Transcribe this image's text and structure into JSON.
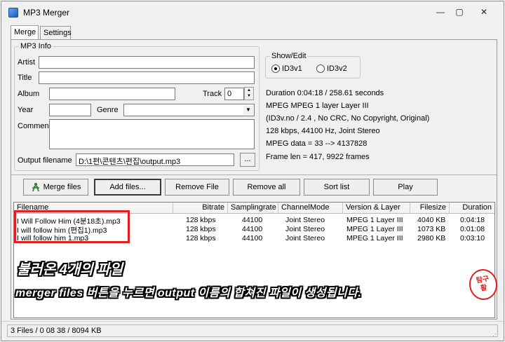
{
  "window": {
    "title": "MP3 Merger",
    "controls": {
      "minimize": "—",
      "maximize": "▢",
      "close": "✕"
    }
  },
  "tabs": [
    {
      "label": "Merge",
      "active": true
    },
    {
      "label": "Settings",
      "active": false
    }
  ],
  "mp3_info": {
    "legend": "MP3 Info",
    "artist_label": "Artist",
    "artist_value": "",
    "title_label": "Title",
    "title_value": "",
    "album_label": "Album",
    "album_value": "",
    "track_label": "Track",
    "track_value": "0",
    "year_label": "Year",
    "year_value": "",
    "genre_label": "Genre",
    "genre_value": "",
    "comment_label": "Comment",
    "comment_value": "",
    "output_label": "Output filename",
    "output_value": "D:\\1편\\콘텐츠\\편집\\output.mp3",
    "browse_label": "..."
  },
  "show_edit": {
    "legend": "Show/Edit",
    "options": [
      {
        "label": "ID3v1",
        "selected": true
      },
      {
        "label": "ID3v2",
        "selected": false
      }
    ]
  },
  "info_lines": [
    "Duration 0:04:18 / 258.61 seconds",
    "MPEG MPEG 1 layer Layer III",
    "(ID3v.no  / 2.4 , No CRC, No Copyright, Original)",
    "128 kbps, 44100 Hz, Joint Stereo",
    "MPEG data = 33 --> 4137828",
    "Frame len = 417, 9922 frames"
  ],
  "toolbar": {
    "merge_files": "Merge files",
    "add_files": "Add files...",
    "remove_file": "Remove File",
    "remove_all": "Remove all",
    "sort_list": "Sort list",
    "play": "Play"
  },
  "table": {
    "columns": [
      "Filename",
      "Bitrate",
      "Samplingrate",
      "ChannelMode",
      "Version & Layer",
      "Filesize",
      "Duration"
    ],
    "rows": [
      [
        "I Will Follow Him (4분18초).mp3",
        "128 kbps",
        "44100",
        "Joint Stereo",
        "MPEG 1 Layer III",
        "4040 KB",
        "0:04:18"
      ],
      [
        "I will follow him (편집1).mp3",
        "128 kbps",
        "44100",
        "Joint Stereo",
        "MPEG 1 Layer III",
        "1073 KB",
        "0:01:08"
      ],
      [
        "I will follow him 1.mp3",
        "128 kbps",
        "44100",
        "Joint Stereo",
        "MPEG 1 Layer III",
        "2980 KB",
        "0:03:10"
      ]
    ]
  },
  "annotations": {
    "caption_1": "불러온 4개의 파일",
    "caption_2": "merger files 버튼을 누르면 output 이름의 합쳐진 파일이 생성됩니다.",
    "stamp_line_1": "탐구",
    "stamp_line_2": "활"
  },
  "status": {
    "text": "3 Files  / 0 08 38 / 8094 KB"
  },
  "colors": {
    "highlight": "#e02020",
    "window_bg": "#f0f0f0"
  }
}
